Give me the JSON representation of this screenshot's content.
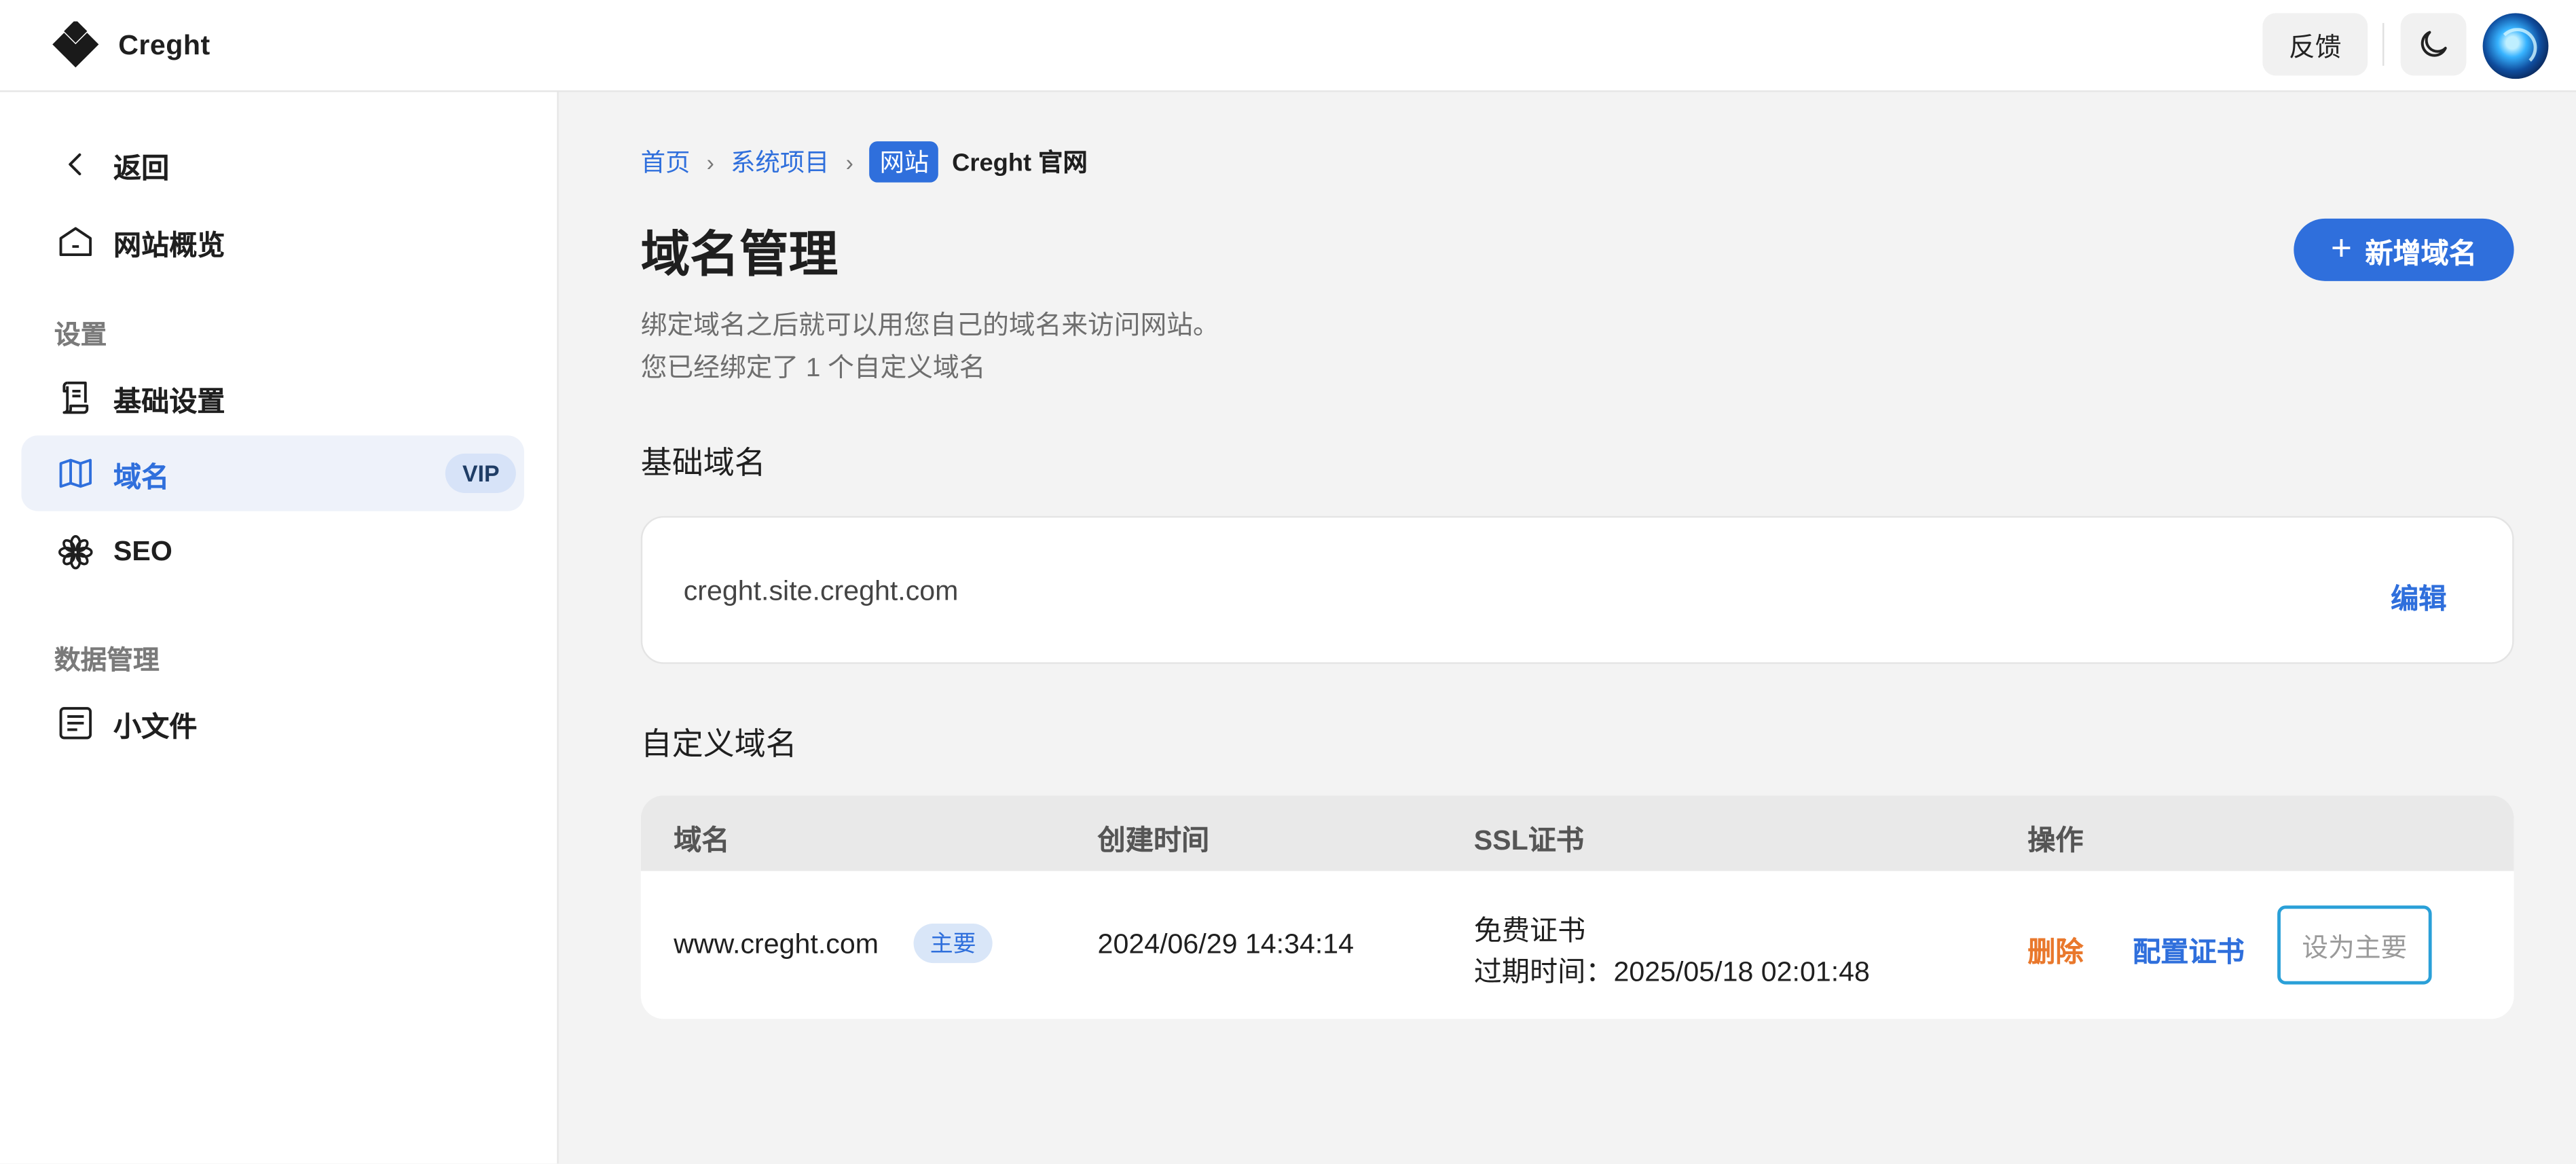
{
  "header": {
    "brand": "Creght",
    "feedback_label": "反馈",
    "theme_icon": "moon-icon",
    "avatar_icon": "avatar"
  },
  "sidebar": {
    "back_label": "返回",
    "overview_label": "网站概览",
    "section_settings": "设置",
    "basic_settings_label": "基础设置",
    "domain_label": "域名",
    "domain_badge": "VIP",
    "seo_label": "SEO",
    "section_data": "数据管理",
    "files_label": "小文件"
  },
  "breadcrumb": {
    "home": "首页",
    "projects": "系统项目",
    "type_badge": "网站",
    "current": "Creght 官网"
  },
  "page": {
    "title": "域名管理",
    "desc_line1": "绑定域名之后就可以用您自己的域名来访问网站。",
    "desc_line2": "您已经绑定了 1 个自定义域名",
    "add_button": "新增域名"
  },
  "base_domain": {
    "section_title": "基础域名",
    "value": "creght.site.creght.com",
    "edit_label": "编辑"
  },
  "custom_domains": {
    "section_title": "自定义域名",
    "columns": [
      "域名",
      "创建时间",
      "SSL证书",
      "操作"
    ],
    "rows": [
      {
        "domain": "www.creght.com",
        "badge": "主要",
        "created": "2024/06/29 14:34:14",
        "ssl_type": "免费证书",
        "ssl_expire": "过期时间：2025/05/18 02:01:48",
        "delete_label": "删除",
        "config_label": "配置证书",
        "set_primary_label": "设为主要"
      }
    ]
  },
  "colors": {
    "accent": "#2f6fdc",
    "danger": "#e9782c",
    "active_bg": "#eef2fa"
  }
}
